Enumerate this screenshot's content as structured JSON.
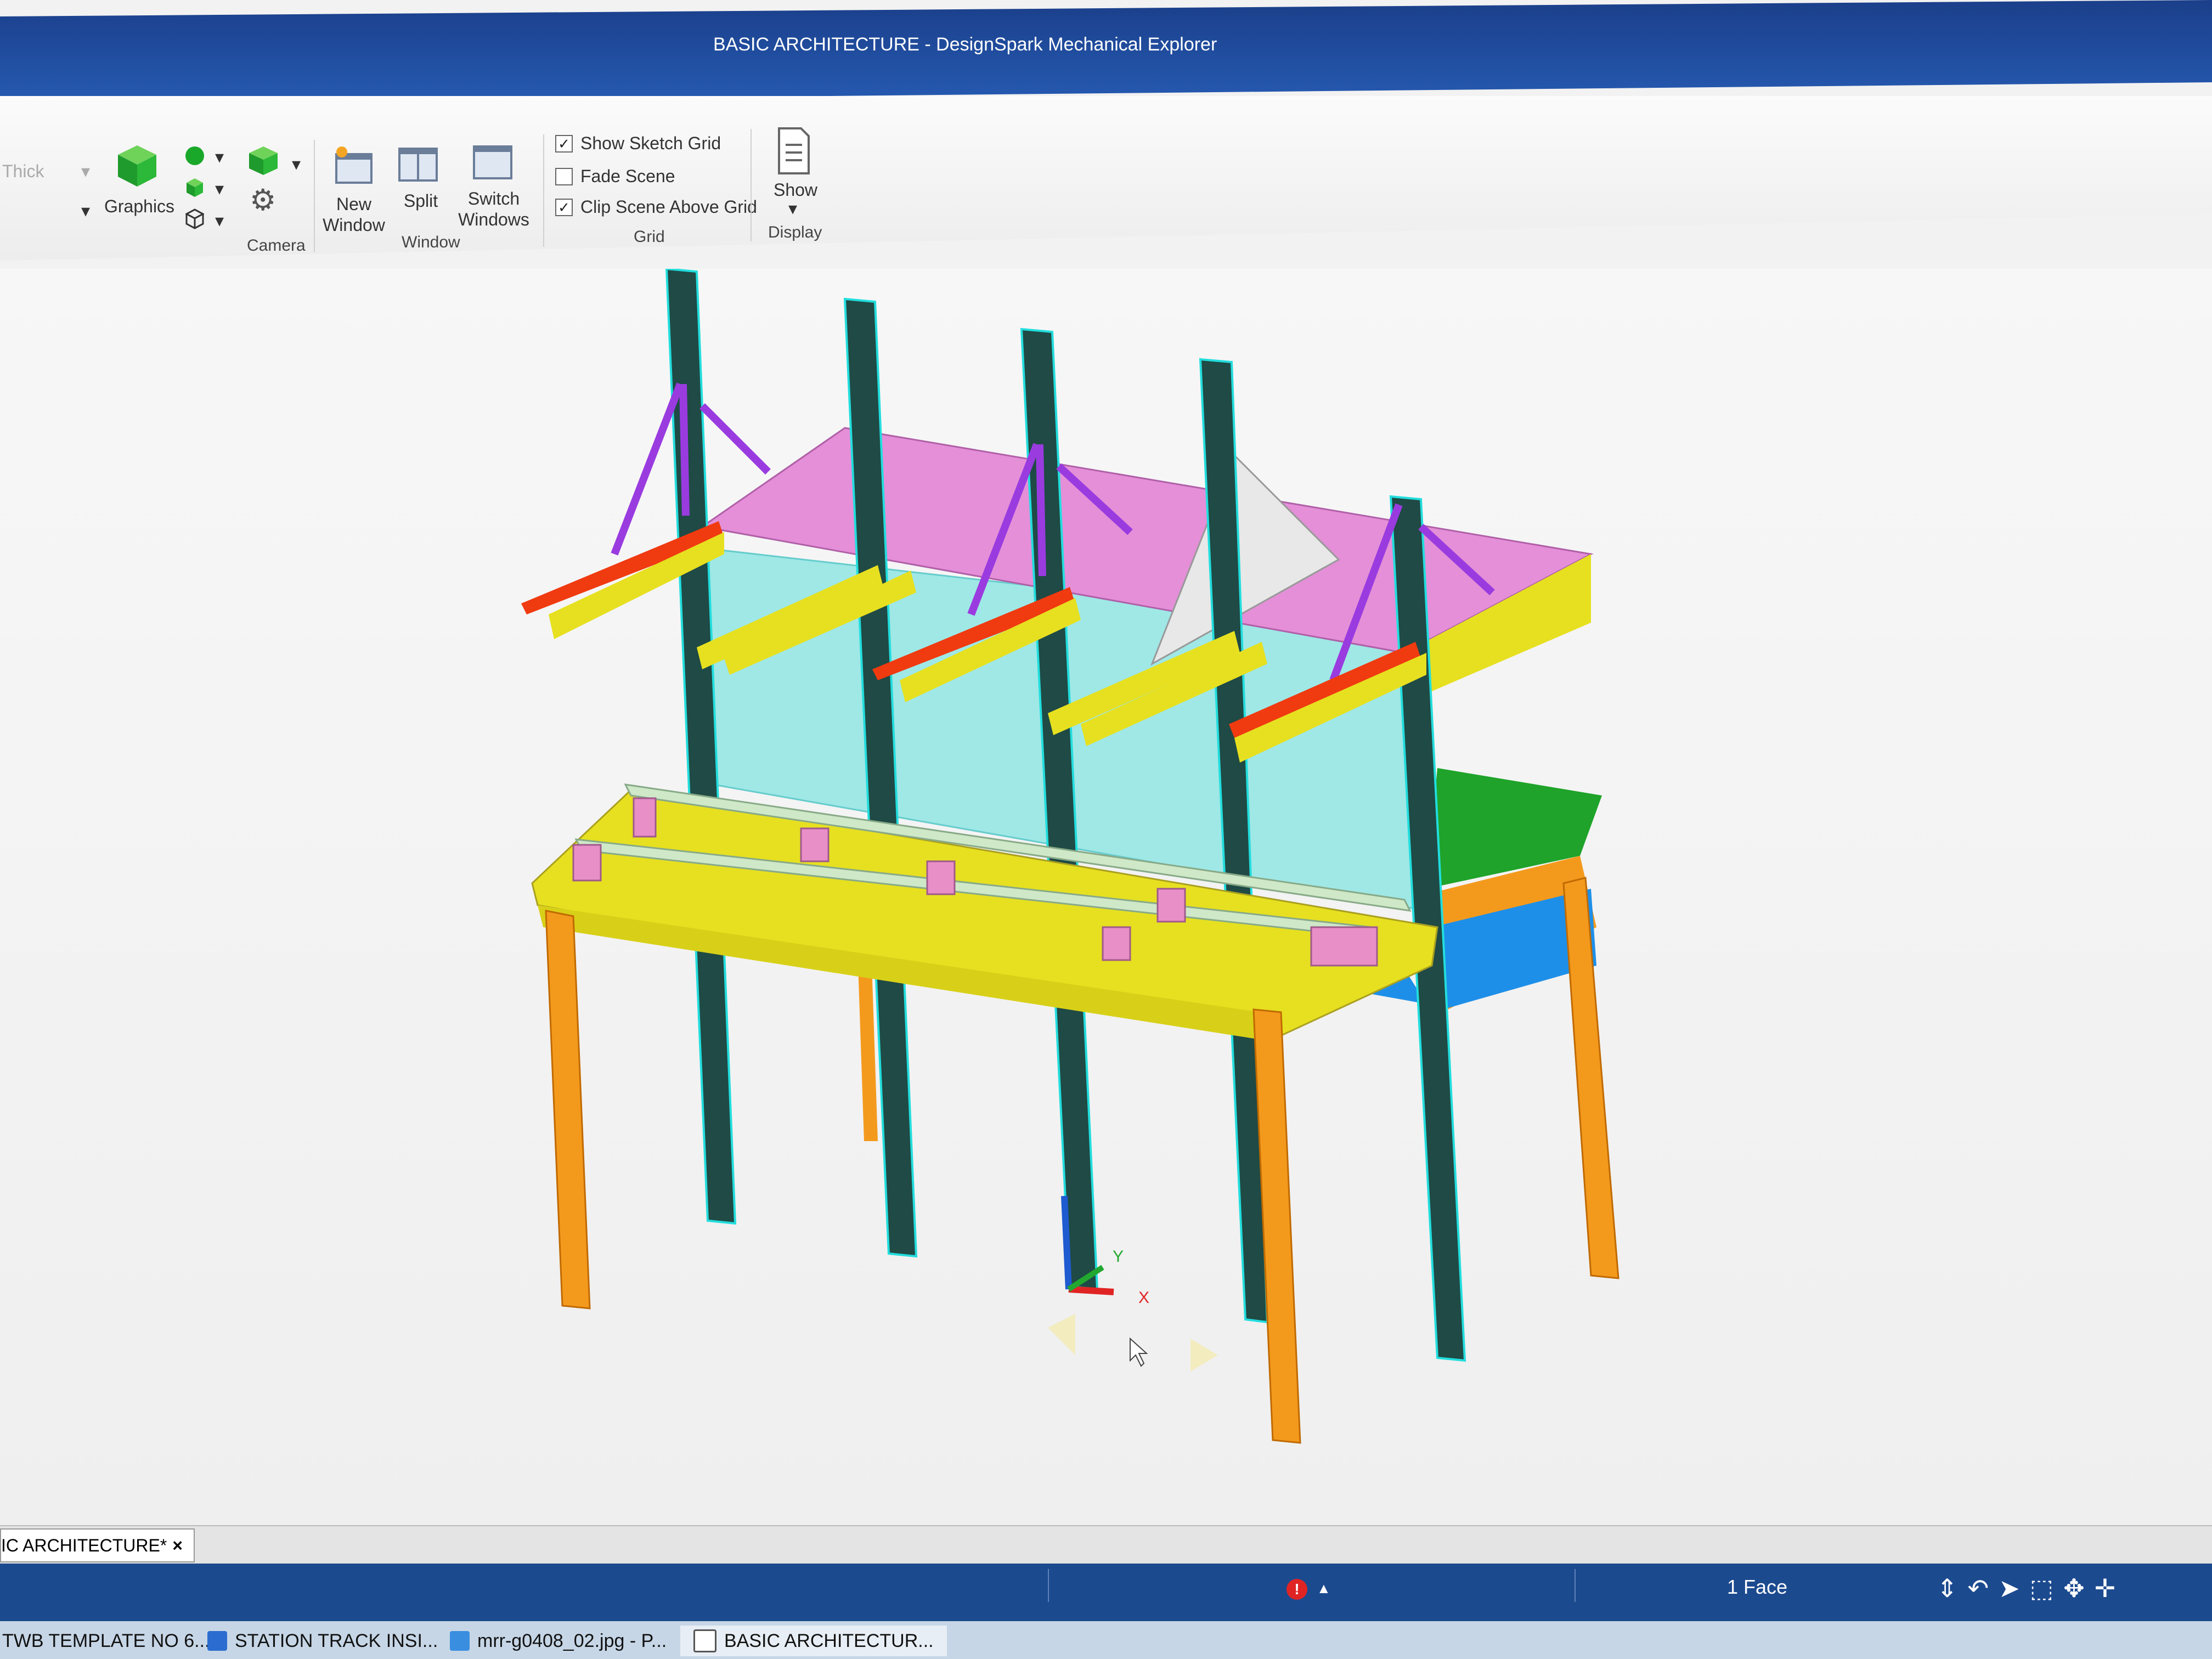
{
  "window": {
    "title": "BASIC ARCHITECTURE - DesignSpark Mechanical Explorer"
  },
  "ribbon": {
    "style_thick": "Thick",
    "graphics_label": "Graphics",
    "camera_group": "Camera",
    "new_window": "New Window",
    "split": "Split",
    "switch_windows": "Switch Windows",
    "window_group": "Window",
    "grid": {
      "group": "Grid",
      "show_sketch_grid": {
        "label": "Show Sketch Grid",
        "checked": true
      },
      "fade_scene": {
        "label": "Fade Scene",
        "checked": false
      },
      "clip_scene": {
        "label": "Clip Scene Above Grid",
        "checked": true
      }
    },
    "show": "Show",
    "display_group": "Display"
  },
  "viewport": {
    "axis_x": "X",
    "axis_y": "Y",
    "colors": {
      "column": "#1f4a45",
      "roof": "#e58fd8",
      "brace": "#9a3be0",
      "beam_yellow": "#e6e020",
      "beam_red": "#f03a10",
      "glass": "#9fe8e6",
      "leg": "#f39a1d",
      "bench_top": "#1fa32a",
      "shelf": "#1e8fe8",
      "block_pink": "#e98fc8",
      "panel_white": "#e8e8e8"
    }
  },
  "doc_tab": {
    "label": "IC ARCHITECTURE*",
    "close": "×"
  },
  "status": {
    "selection": "1 Face"
  },
  "taskbar": {
    "items": [
      {
        "label": "TWB TEMPLATE NO 6...",
        "icon": "excel-icon"
      },
      {
        "label": "STATION TRACK INSI...",
        "icon": "visio-icon"
      },
      {
        "label": "mrr-g0408_02.jpg - P...",
        "icon": "paint-icon"
      },
      {
        "label": "BASIC ARCHITECTUR...",
        "icon": "designspark-icon"
      }
    ]
  }
}
